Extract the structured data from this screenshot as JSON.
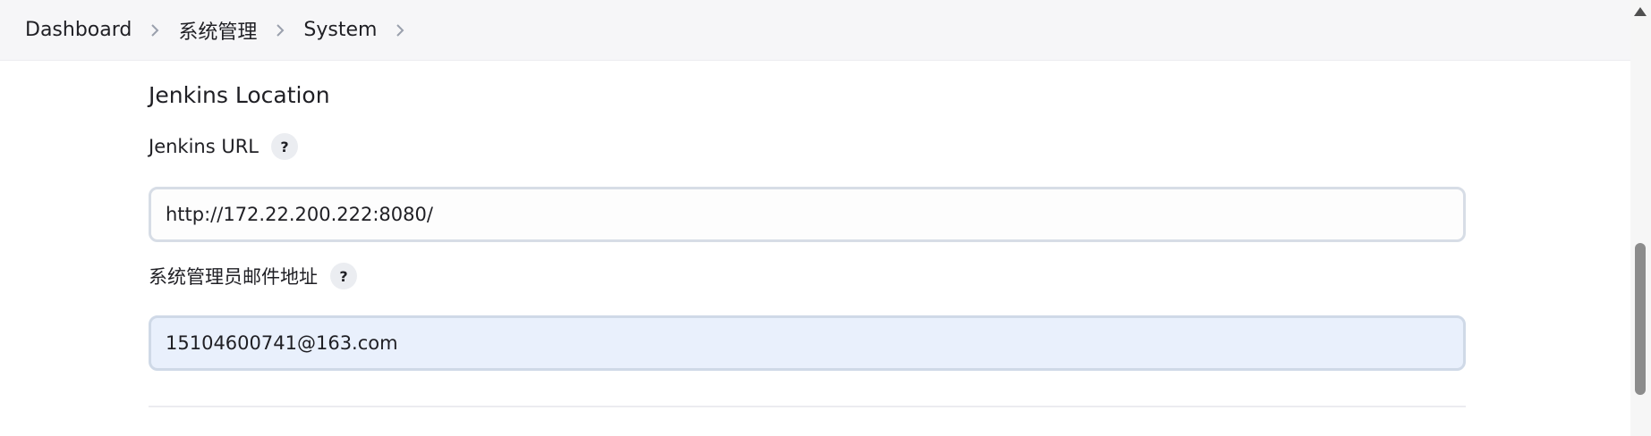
{
  "breadcrumb": {
    "items": [
      {
        "label": "Dashboard"
      },
      {
        "label": "系统管理"
      },
      {
        "label": "System"
      }
    ]
  },
  "section": {
    "title": "Jenkins Location"
  },
  "fields": {
    "jenkins_url": {
      "label": "Jenkins URL",
      "help": "?",
      "value": "http://172.22.200.222:8080/"
    },
    "admin_email": {
      "label": "系统管理员邮件地址",
      "help": "?",
      "value": "15104600741@163.com"
    }
  },
  "icons": {
    "breadcrumb_separator": "chevron-right-icon",
    "help": "help-icon",
    "scroll_up": "arrow-up-icon"
  },
  "colors": {
    "breadcrumb_bg": "#f6f6f8",
    "input_border": "#d7dde6",
    "input_filled_bg": "#e9f0fc"
  }
}
